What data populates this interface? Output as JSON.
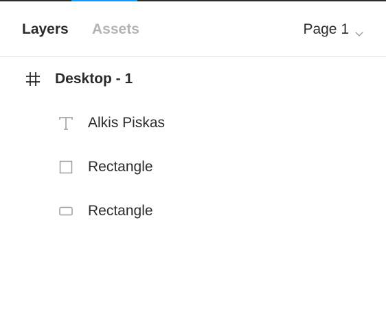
{
  "header": {
    "tabs": [
      {
        "label": "Layers",
        "active": true
      },
      {
        "label": "Assets",
        "active": false
      }
    ],
    "page_select": {
      "value": "Page 1",
      "icon": "chevron-down-icon"
    }
  },
  "layers": [
    {
      "label": "Desktop - 1",
      "icon": "frame-icon",
      "depth": 0
    },
    {
      "label": "Alkis Piskas",
      "icon": "text-icon",
      "depth": 1
    },
    {
      "label": "Rectangle",
      "icon": "square-icon",
      "depth": 1
    },
    {
      "label": "Rectangle",
      "icon": "rounded-rectangle-icon",
      "depth": 1
    }
  ],
  "colors": {
    "accent": "#0d99ff",
    "text": "#2b2b2b",
    "inactive_tab": "#b3b3b3",
    "icon": "#9a9a9a"
  }
}
